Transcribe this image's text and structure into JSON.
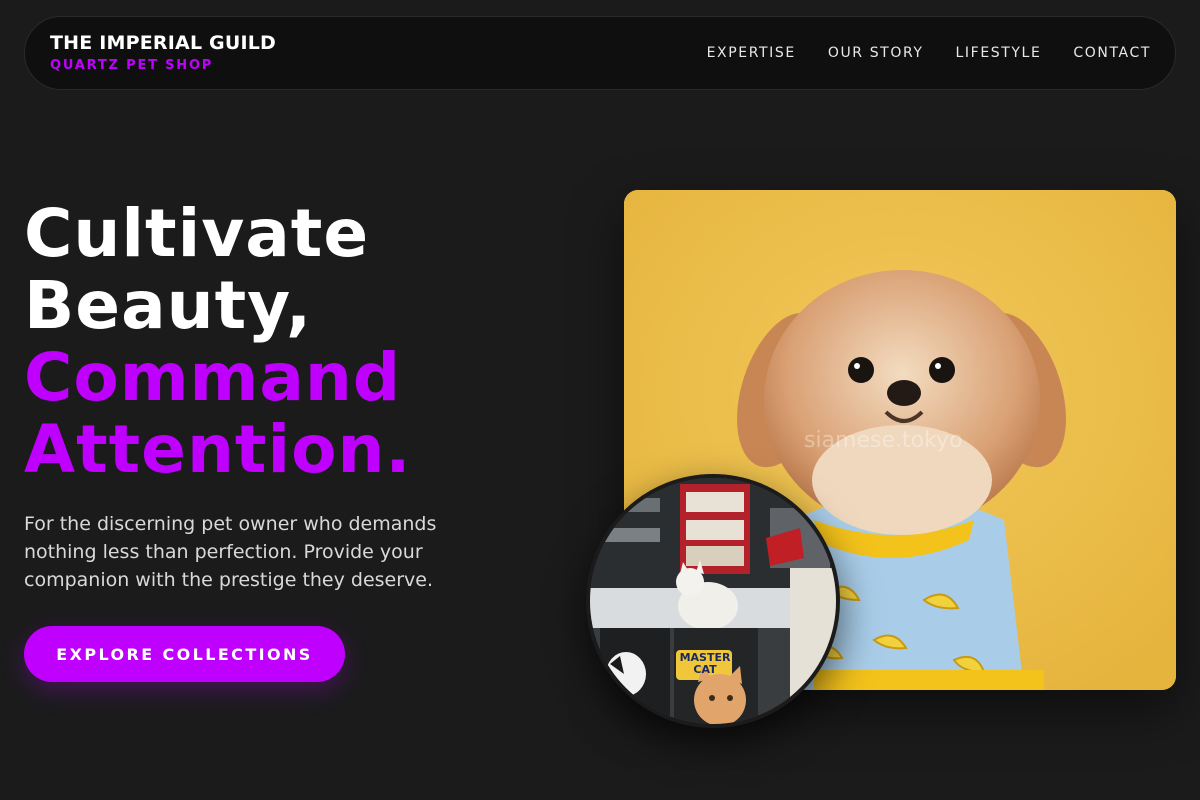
{
  "nav": {
    "brand_title": "THE IMPERIAL GUILD",
    "brand_subtitle": "QUARTZ PET SHOP",
    "links": [
      "EXPERTISE",
      "OUR STORY",
      "LIFESTYLE",
      "CONTACT"
    ]
  },
  "hero": {
    "title_line1": "Cultivate",
    "title_line2": "Beauty,",
    "title_line3": "Command",
    "title_line4": "Attention.",
    "description": "For the discerning pet owner who demands nothing less than perfection. Provide your companion with the prestige they deserve.",
    "cta_label": "EXPLORE COLLECTIONS"
  },
  "images": {
    "main_watermark": "siamese.tokyo",
    "inset_sign": "MASTER CAT"
  },
  "colors": {
    "accent": "#bf00ff",
    "background": "#1b1b1c",
    "nav_background": "#0f0f10",
    "photo_background": "#eec14f"
  }
}
